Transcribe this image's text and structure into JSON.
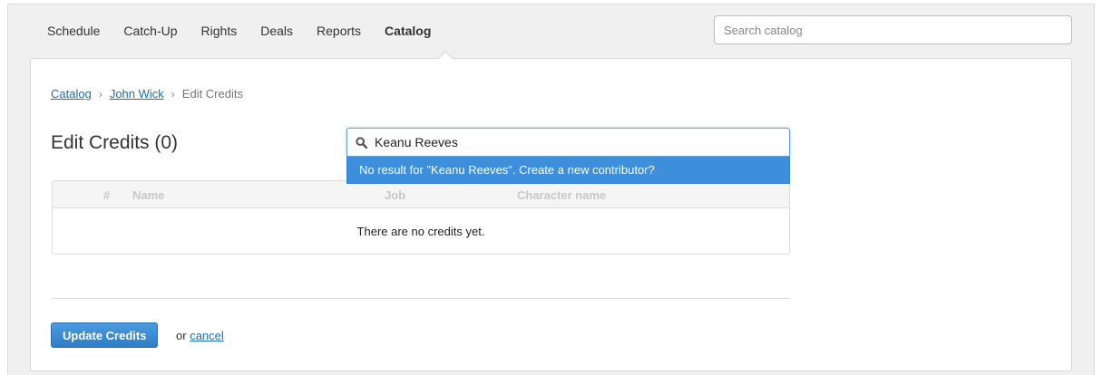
{
  "nav": {
    "items": [
      {
        "label": "Schedule",
        "active": false
      },
      {
        "label": "Catch-Up",
        "active": false
      },
      {
        "label": "Rights",
        "active": false
      },
      {
        "label": "Deals",
        "active": false
      },
      {
        "label": "Reports",
        "active": false
      },
      {
        "label": "Catalog",
        "active": true
      }
    ],
    "search_placeholder": "Search catalog"
  },
  "breadcrumb": {
    "root": "Catalog",
    "parent": "John Wick",
    "current": "Edit Credits",
    "separator": "›"
  },
  "page": {
    "title": "Edit Credits (0)"
  },
  "contributor_search": {
    "icon": "search-icon",
    "value": "Keanu Reeves",
    "result_text": "No result for \"Keanu Reeves\". Create a new contributor?"
  },
  "credits_table": {
    "columns": [
      "#",
      "Name",
      "Job",
      "Character name"
    ],
    "empty_message": "There are no credits yet."
  },
  "actions": {
    "update_label": "Update Credits",
    "or_text": "or",
    "cancel_label": "cancel"
  },
  "colors": {
    "accent": "#3d8fdb",
    "link": "#1a6fb5"
  }
}
